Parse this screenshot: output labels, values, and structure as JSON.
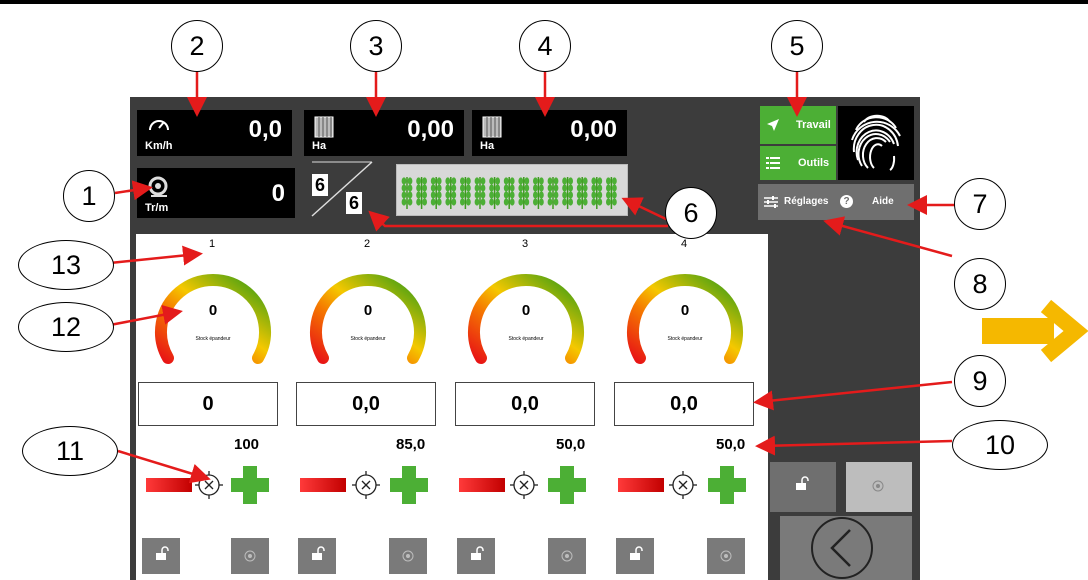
{
  "markers": [
    "1",
    "2",
    "3",
    "4",
    "5",
    "6",
    "7",
    "8",
    "9",
    "10",
    "11",
    "12",
    "13"
  ],
  "top_tiles": {
    "speed": {
      "value": "0,0",
      "unit": "Km/h",
      "icon": "speedometer-icon"
    },
    "area_partial": {
      "value": "0,00",
      "unit": "Ha",
      "icon": "field-grid-icon"
    },
    "area_total": {
      "value": "0,00",
      "unit": "Ha",
      "icon": "field-grid-icon"
    },
    "rpm": {
      "value": "0",
      "unit": "Tr/m",
      "icon": "disc-rotation-icon"
    }
  },
  "sections": {
    "active": "6",
    "total": "6",
    "crop_icons": 15
  },
  "menu": {
    "work_label": "Travail",
    "tools_label": "Outils",
    "settings_label": "Réglages",
    "help_label": "Aide"
  },
  "spreaders": [
    {
      "number": "1",
      "gauge_value": "0",
      "gauge_label": "Stock épandeur",
      "rate": "0",
      "percent": "100"
    },
    {
      "number": "2",
      "gauge_value": "0",
      "gauge_label": "Stock épandeur",
      "rate": "0,0",
      "percent": "85,0"
    },
    {
      "number": "3",
      "gauge_value": "0",
      "gauge_label": "Stock épandeur",
      "rate": "0,0",
      "percent": "50,0"
    },
    {
      "number": "4",
      "gauge_value": "0",
      "gauge_label": "Stock épandeur",
      "rate": "0,0",
      "percent": "50,0"
    }
  ],
  "colors": {
    "green": "#4caf35",
    "red": "#e41b1b",
    "panel_dark": "#3c3c3c",
    "arrow_red": "#e41b1b",
    "next_arrow": "#f5b800"
  }
}
